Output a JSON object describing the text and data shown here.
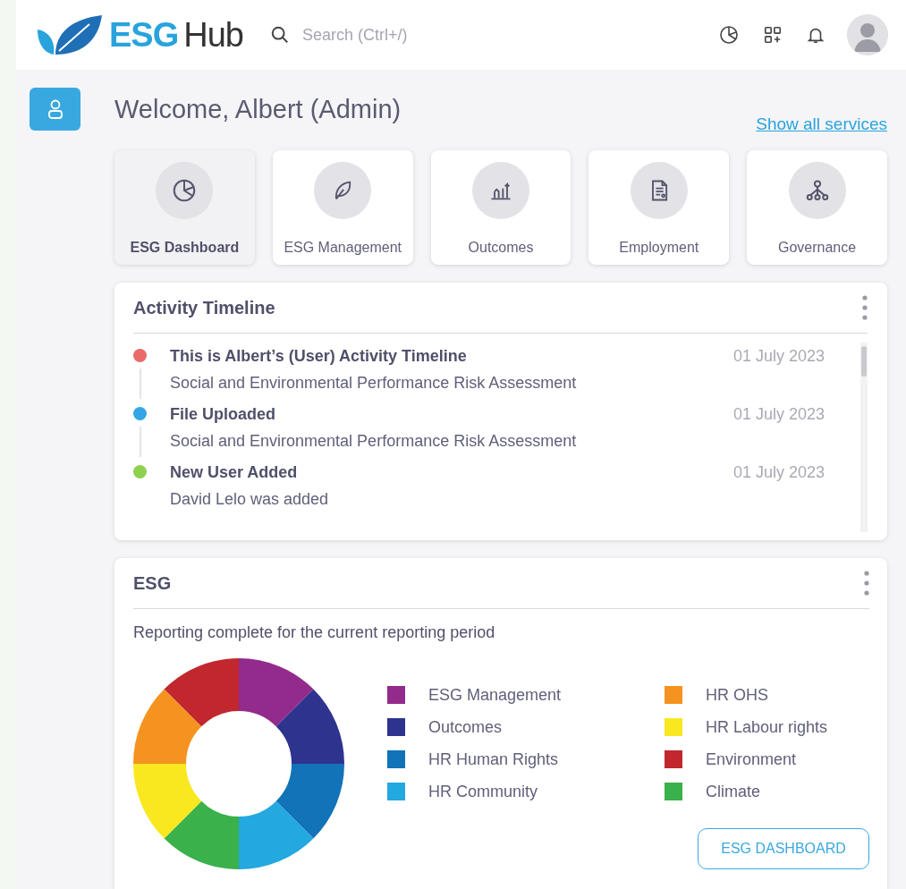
{
  "header": {
    "logo_part_1": "ESG",
    "logo_part_2": "Hub",
    "search": {
      "placeholder": "Search (Ctrl+/)"
    }
  },
  "welcome": "Welcome, Albert (Admin)",
  "show_all_link": "Show all services",
  "services": [
    {
      "label": "ESG Dashboard",
      "selected": true
    },
    {
      "label": "ESG Management",
      "selected": false
    },
    {
      "label": "Outcomes",
      "selected": false
    },
    {
      "label": "Employment",
      "selected": false
    },
    {
      "label": "Governance",
      "selected": false
    }
  ],
  "activity_timeline": {
    "title": "Activity Timeline",
    "items": [
      {
        "title": "This is Albert’s (User) Activity Timeline",
        "detail": "Social and Environmental Performance Risk Assessment",
        "date": "01 July 2023",
        "color": "#ea6a6a"
      },
      {
        "title": "File Uploaded",
        "detail": "Social and Environmental Performance Risk Assessment",
        "date": "01 July 2023",
        "color": "#35a6e3"
      },
      {
        "title": "New User Added",
        "detail": "David Lelo was added",
        "date": "01 July 2023",
        "color": "#8fd14f"
      }
    ]
  },
  "esg": {
    "title": "ESG",
    "subtitle": "Reporting complete for the current reporting period",
    "legend": [
      {
        "label": "ESG Management",
        "color": "#922b8c"
      },
      {
        "label": "Outcomes",
        "color": "#2e338e"
      },
      {
        "label": "HR Human Rights",
        "color": "#1273b8"
      },
      {
        "label": "HR Community",
        "color": "#23a8e0"
      },
      {
        "label": "HR OHS",
        "color": "#f59320"
      },
      {
        "label": "HR Labour rights",
        "color": "#f9e81f"
      },
      {
        "label": "Environment",
        "color": "#c1272d"
      },
      {
        "label": "Climate",
        "color": "#3ab14a"
      }
    ],
    "button": "ESG DASHBOARD"
  }
}
